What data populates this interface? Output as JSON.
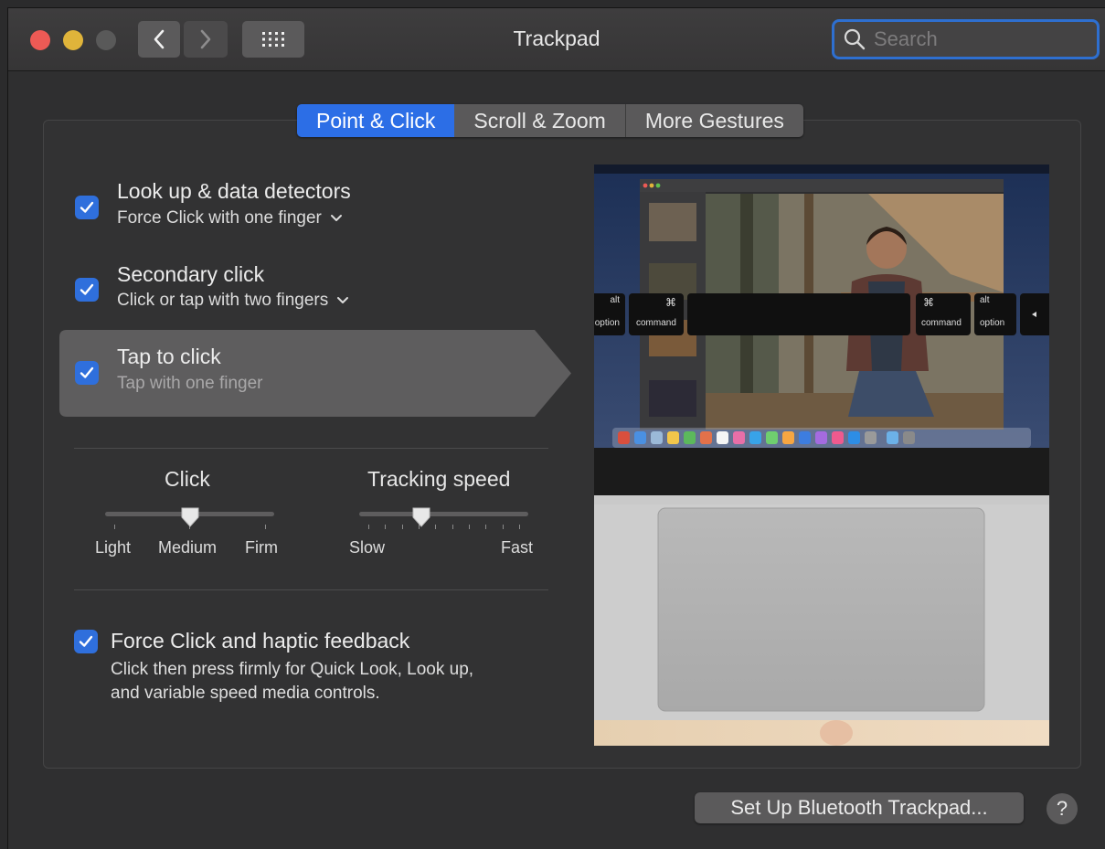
{
  "window": {
    "title": "Trackpad",
    "search_placeholder": "Search"
  },
  "tabs": [
    {
      "label": "Point & Click",
      "active": true
    },
    {
      "label": "Scroll & Zoom",
      "active": false
    },
    {
      "label": "More Gestures",
      "active": false
    }
  ],
  "options": [
    {
      "title": "Look up & data detectors",
      "subtitle": "Force Click with one finger",
      "checked": true,
      "has_dropdown": true
    },
    {
      "title": "Secondary click",
      "subtitle": "Click or tap with two fingers",
      "checked": true,
      "has_dropdown": true
    },
    {
      "title": "Tap to click",
      "subtitle": "Tap with one finger",
      "checked": true,
      "has_dropdown": false,
      "selected": true
    }
  ],
  "click_slider": {
    "label": "Click",
    "ticks": [
      "Light",
      "Medium",
      "Firm"
    ],
    "value": "Medium"
  },
  "tracking_slider": {
    "label": "Tracking speed",
    "min_label": "Slow",
    "max_label": "Fast",
    "value_fraction": 0.35
  },
  "force_click": {
    "title": "Force Click and haptic feedback",
    "description_line1": "Click then press firmly for Quick Look, Look up,",
    "description_line2": "and variable speed media controls.",
    "checked": true
  },
  "preview": {
    "keys": [
      "alt",
      "option",
      "⌘",
      "command",
      "⌘",
      "command",
      "alt",
      "option"
    ]
  },
  "footer": {
    "setup_button": "Set Up Bluetooth Trackpad...",
    "help": "?"
  },
  "colors": {
    "accent": "#2c6ee6",
    "close": "#ed5a55",
    "minimize": "#e0b43a"
  }
}
